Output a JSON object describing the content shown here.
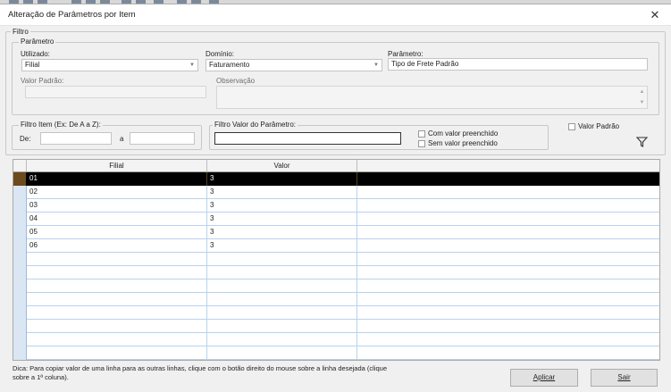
{
  "window": {
    "title": "Alteração de Parâmetros por Item",
    "close_label": "✕"
  },
  "filtro": {
    "legend": "Filtro",
    "parametro_group": {
      "legend": "Parâmetro",
      "utilizado": {
        "label": "Utilizado:",
        "value": "Filial"
      },
      "dominio": {
        "label": "Domínio:",
        "value": "Faturamento"
      },
      "parametro": {
        "label": "Parâmetro:",
        "value": "Tipo de Frete Padrão"
      },
      "valor_padrao": {
        "label": "Valor Padrão:",
        "value": ""
      },
      "observacao": {
        "label": "Observação",
        "value": ""
      }
    },
    "filtro_item": {
      "legend": "Filtro Item (Ex: De A a Z):",
      "de_label": "De:",
      "de_value": "",
      "a_label": "a",
      "a_value": ""
    },
    "filtro_valor": {
      "legend": "Filtro Valor do Parâmetro:",
      "value": "",
      "com_valor": "Com valor preenchido",
      "sem_valor": "Sem valor preenchido"
    },
    "valor_padrao_check": {
      "label": "Valor Padrão",
      "checked": false
    },
    "filter_icon": "funnel-icon"
  },
  "grid": {
    "columns": [
      "Filial",
      "Valor"
    ],
    "rows": [
      {
        "filial": "01",
        "valor": "3",
        "selected": true
      },
      {
        "filial": "02",
        "valor": "3"
      },
      {
        "filial": "03",
        "valor": "3"
      },
      {
        "filial": "04",
        "valor": "3"
      },
      {
        "filial": "05",
        "valor": "3"
      },
      {
        "filial": "06",
        "valor": "3"
      }
    ]
  },
  "footer": {
    "hint": "Dica: Para copiar valor de uma linha para as outras linhas, clique com o botão direito do mouse sobre a linha desejada (clique sobre a 1ª coluna).",
    "aplicar_label": "Aplicar",
    "sair_label": "Sair"
  }
}
